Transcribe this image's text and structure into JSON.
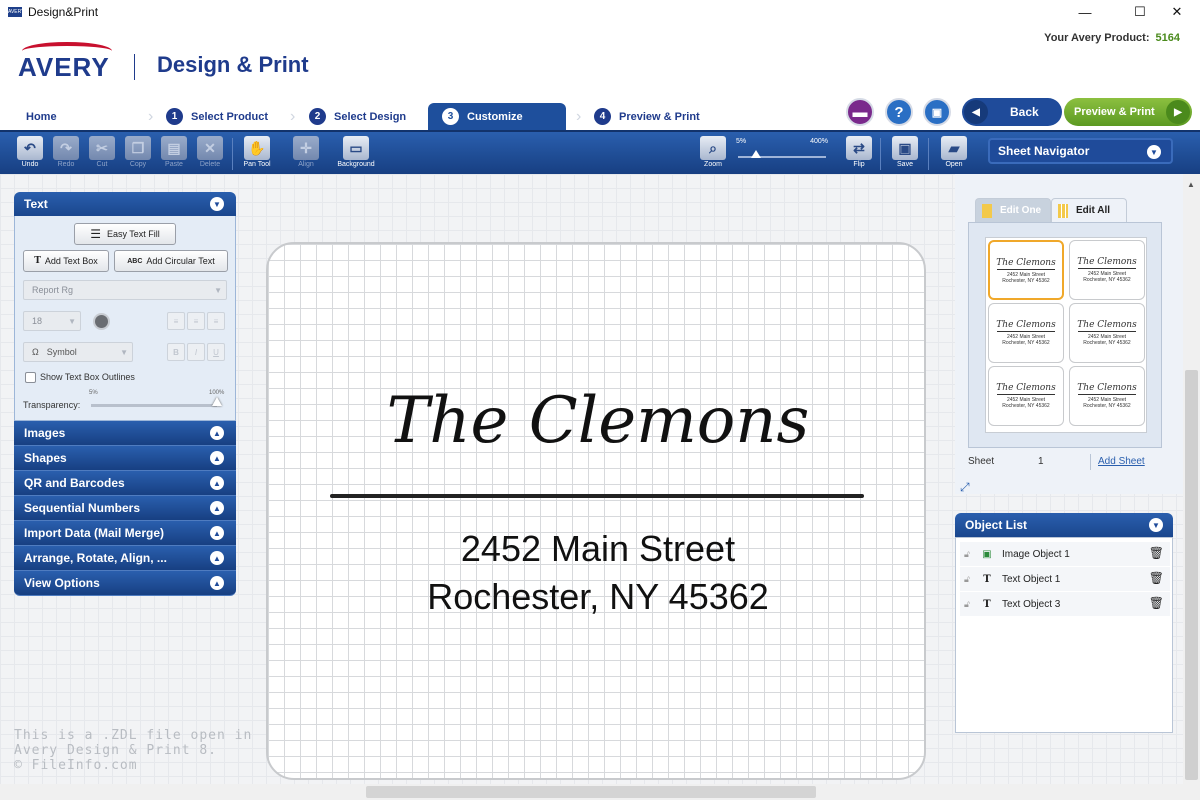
{
  "window": {
    "title": "Design&Print",
    "controls": [
      "—",
      "☐",
      "✕"
    ]
  },
  "header": {
    "logo": "AVERY",
    "brand": "Design & Print",
    "product_label": "Your Avery Product:",
    "product_number": "5164"
  },
  "steps": {
    "home": "Home",
    "s1": "Select Product",
    "s2": "Select Design",
    "s3": "Customize",
    "s4": "Preview & Print",
    "n1": "1",
    "n2": "2",
    "n3": "3",
    "n4": "4"
  },
  "nav": {
    "back": "Back",
    "preview_print": "Preview & Print"
  },
  "toolbar": {
    "undo": "Undo",
    "redo": "Redo",
    "cut": "Cut",
    "copy": "Copy",
    "paste": "Paste",
    "delete": "Delete",
    "pan": "Pan Tool",
    "align": "Align",
    "background": "Background",
    "zoom": "Zoom",
    "zoom_min": "5%",
    "zoom_max": "400%",
    "zoom_level": 0.2,
    "flip": "Flip",
    "save": "Save",
    "open": "Open"
  },
  "sheet_navigator": {
    "title": "Sheet Navigator",
    "tab_edit_one": "Edit One",
    "tab_edit_all": "Edit All",
    "sheet_label": "Sheet",
    "sheet_number": "1",
    "add_sheet": "Add Sheet",
    "mini_name": "The Clemons",
    "mini_addr1": "2452 Main Street",
    "mini_addr2": "Rochester, NY 45362"
  },
  "text_panel": {
    "title": "Text",
    "easy_fill": "Easy Text Fill",
    "add_text_box": "Add Text Box",
    "add_circular": "Add Circular Text",
    "font": "Report Rg",
    "size": "18",
    "symbol": "Symbol",
    "show_outlines": "Show Text Box Outlines",
    "transparency": "Transparency:",
    "t_min": "5%",
    "t_max": "100%",
    "transparency_value": 1.0
  },
  "accordion": [
    "Images",
    "Shapes",
    "QR and Barcodes",
    "Sequential Numbers",
    "Import Data (Mail Merge)",
    "Arrange, Rotate, Align, ...",
    "View Options"
  ],
  "label": {
    "name": "The Clemons",
    "addr1": "2452 Main Street",
    "addr2": "Rochester, NY 45362"
  },
  "watermark": {
    "l1": "This is a .ZDL file open in",
    "l2": "Avery Design & Print 8.",
    "l3": "© FileInfo.com"
  },
  "object_list": {
    "title": "Object List",
    "items": [
      "Image Object 1",
      "Text Object 1",
      "Text Object 3"
    ]
  },
  "colors": {
    "brand_blue": "#1f3b8c",
    "accent_green": "#5c9a22",
    "avery_red": "#c8102e",
    "selection": "#f0a82a"
  }
}
